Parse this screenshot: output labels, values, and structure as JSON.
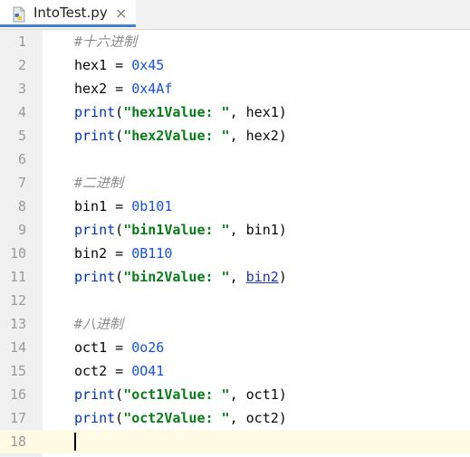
{
  "tab": {
    "title": "IntoTest.py",
    "close_glyph": "×",
    "icon": "python-file-icon"
  },
  "lines": [
    {
      "n": "1",
      "kind": "comment",
      "text": "#十六进制"
    },
    {
      "n": "2",
      "kind": "assign",
      "name": "hex1",
      "op": " = ",
      "value": "0x45"
    },
    {
      "n": "3",
      "kind": "assign",
      "name": "hex2",
      "op": " = ",
      "value": "0x4Af"
    },
    {
      "n": "4",
      "kind": "print",
      "fn": "print",
      "open": "(",
      "str": "\"hex1Value: \"",
      "sep": ", ",
      "arg": "hex1",
      "close": ")"
    },
    {
      "n": "5",
      "kind": "print",
      "fn": "print",
      "open": "(",
      "str": "\"hex2Value: \"",
      "sep": ", ",
      "arg": "hex2",
      "close": ")"
    },
    {
      "n": "6",
      "kind": "empty"
    },
    {
      "n": "7",
      "kind": "comment",
      "text": "#二进制"
    },
    {
      "n": "8",
      "kind": "assign",
      "name": "bin1",
      "op": " = ",
      "value": "0b101"
    },
    {
      "n": "9",
      "kind": "print",
      "fn": "print",
      "open": "(",
      "str": "\"bin1Value: \"",
      "sep": ", ",
      "arg": "bin1",
      "close": ")"
    },
    {
      "n": "10",
      "kind": "assign",
      "name": "bin2",
      "op": " = ",
      "value": "0B110"
    },
    {
      "n": "11",
      "kind": "print",
      "fn": "print",
      "open": "(",
      "str": "\"bin2Value: \"",
      "sep": ", ",
      "arg": "bin2",
      "close": ")",
      "arg_underlined": true
    },
    {
      "n": "12",
      "kind": "empty"
    },
    {
      "n": "13",
      "kind": "comment",
      "text": "#八进制"
    },
    {
      "n": "14",
      "kind": "assign",
      "name": "oct1",
      "op": " = ",
      "value": "0o26"
    },
    {
      "n": "15",
      "kind": "assign",
      "name": "oct2",
      "op": " = ",
      "value": "0O41"
    },
    {
      "n": "16",
      "kind": "print",
      "fn": "print",
      "open": "(",
      "str": "\"oct1Value: \"",
      "sep": ", ",
      "arg": "oct1",
      "close": ")"
    },
    {
      "n": "17",
      "kind": "print",
      "fn": "print",
      "open": "(",
      "str": "\"oct2Value: \"",
      "sep": ", ",
      "arg": "oct2",
      "close": ")"
    },
    {
      "n": "18",
      "kind": "empty",
      "current": true
    }
  ],
  "colors": {
    "comment": "#8c8c8c",
    "keyword": "#0033b3",
    "number": "#1750eb",
    "string": "#067d17",
    "current_line": "#fffae3",
    "gutter": "#f0f0f0",
    "tab_accent": "#4083c9"
  }
}
